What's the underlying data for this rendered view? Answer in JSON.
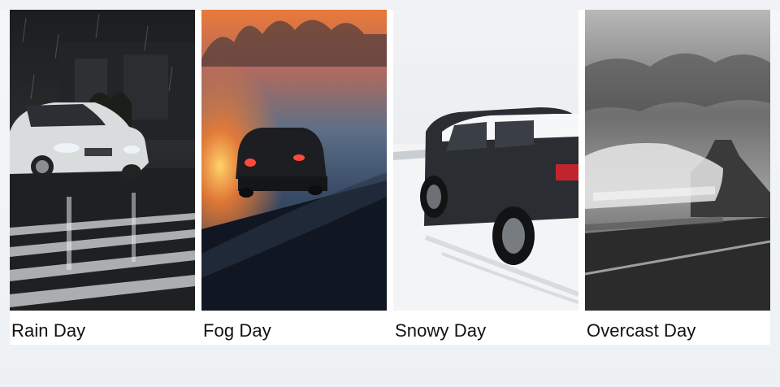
{
  "cards": [
    {
      "caption": "Rain Day",
      "scene": "rain-car-icon"
    },
    {
      "caption": "Fog Day",
      "scene": "fog-car-icon"
    },
    {
      "caption": "Snowy Day",
      "scene": "snow-car-icon"
    },
    {
      "caption": "Overcast Day",
      "scene": "overcast-car-icon"
    }
  ]
}
